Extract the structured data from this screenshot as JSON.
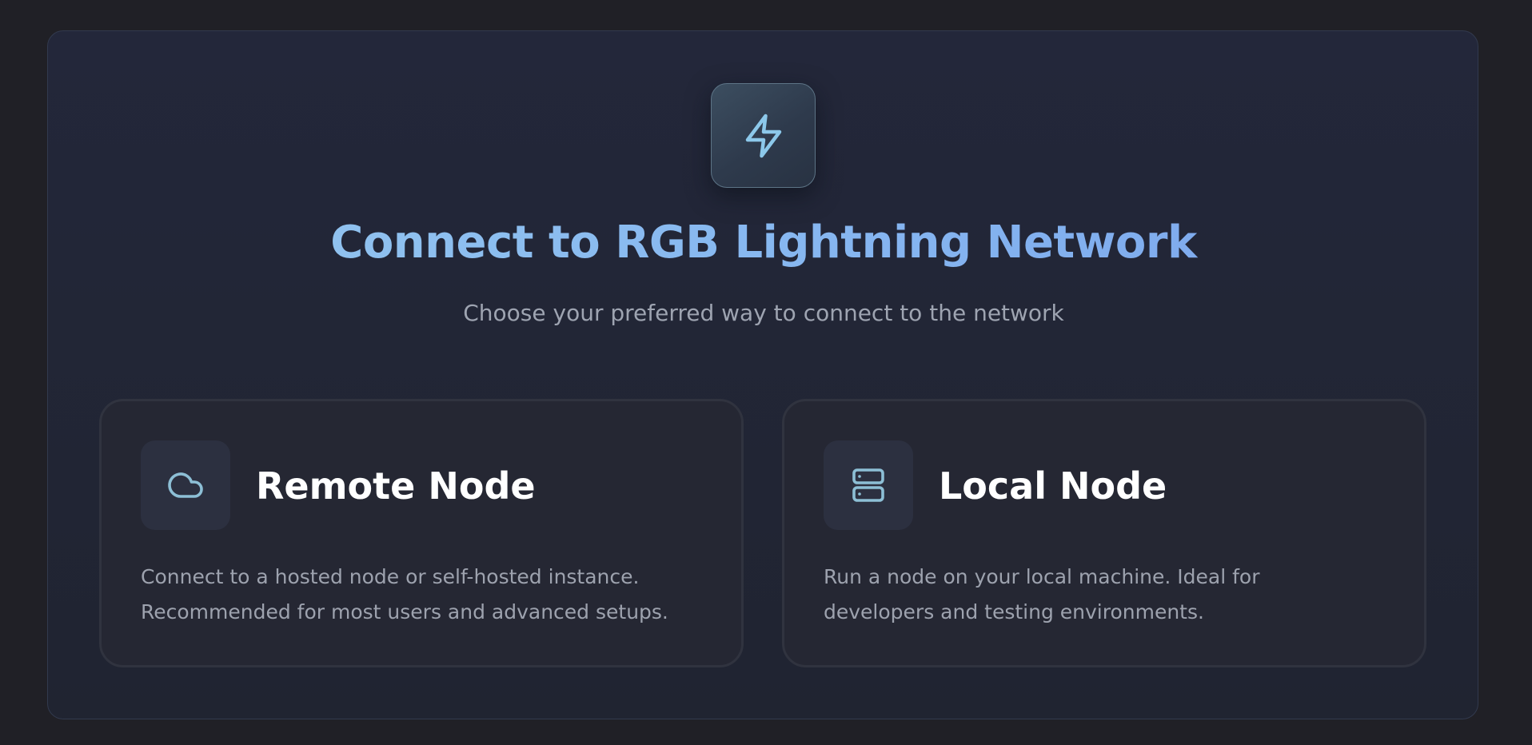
{
  "colors": {
    "background": "#202026",
    "panel": "#22263a",
    "accent": "#8cc3e8",
    "title_gradient_start": "#95c8ee",
    "title_gradient_end": "#7aa4ec",
    "card": "#252733",
    "text_primary": "#ffffff",
    "text_secondary": "#9da2ae"
  },
  "header": {
    "icon": "lightning-bolt-icon",
    "title": "Connect to RGB Lightning Network",
    "subtitle": "Choose your preferred way to connect to the network"
  },
  "options": [
    {
      "icon": "cloud-icon",
      "title": "Remote Node",
      "description_line1": "Connect to a hosted node or self-hosted instance.",
      "description_line2": "Recommended for most users and advanced setups."
    },
    {
      "icon": "server-icon",
      "title": "Local Node",
      "description_line1": "Run a node on your local machine. Ideal for",
      "description_line2": "developers and testing environments."
    }
  ]
}
